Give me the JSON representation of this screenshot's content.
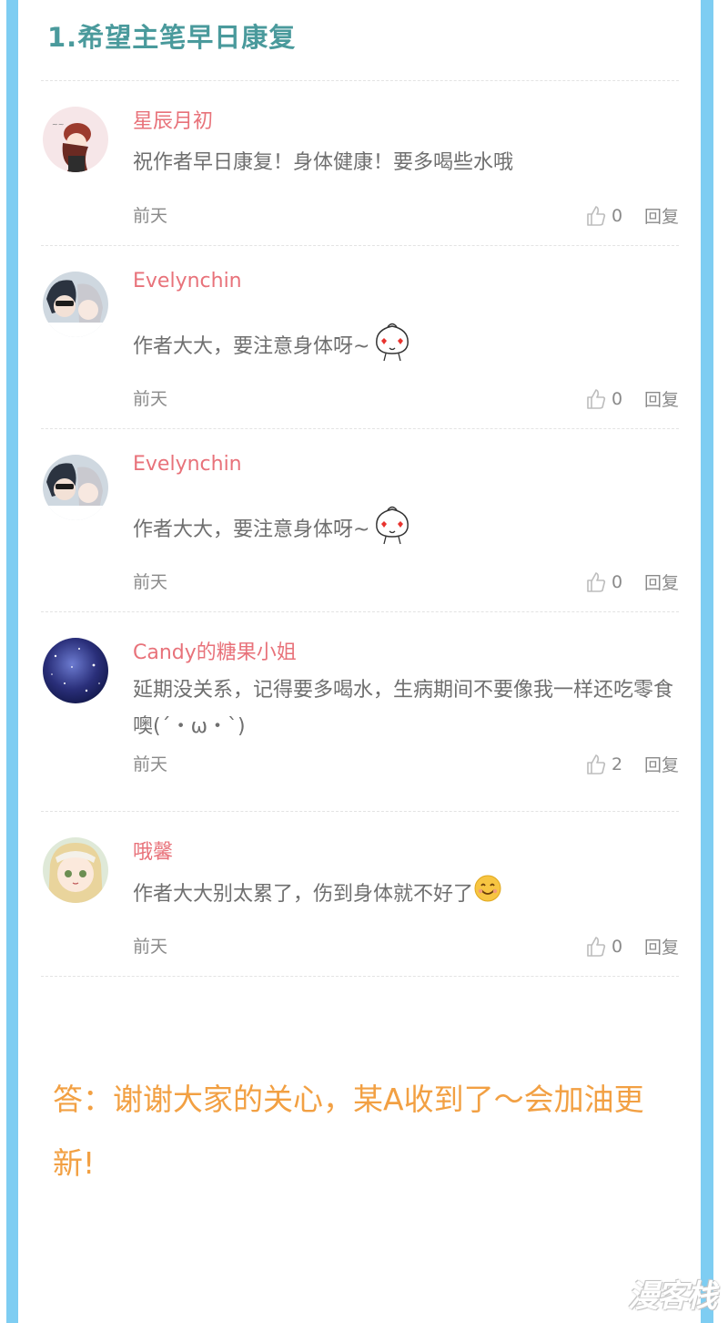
{
  "section": {
    "title": "1.希望主笔早日康复"
  },
  "comments": [
    {
      "user": "星辰月初",
      "text": "祝作者早日康复！身体健康！要多喝些水哦",
      "time": "前天",
      "likes": "0",
      "reply_label": "回复",
      "avatar_icon": "girl-avatar-icon"
    },
    {
      "user": "Evelynchin",
      "text": "作者大大，要注意身体呀~",
      "emoji": "bun-heart-eyes-emoji",
      "time": "前天",
      "likes": "0",
      "reply_label": "回复",
      "avatar_icon": "couple-avatar-icon"
    },
    {
      "user": "Evelynchin",
      "text": "作者大大，要注意身体呀~",
      "emoji": "bun-heart-eyes-emoji",
      "time": "前天",
      "likes": "0",
      "reply_label": "回复",
      "avatar_icon": "couple-avatar-icon"
    },
    {
      "user": "Candy的糖果小姐",
      "text": "延期没关系，记得要多喝水，生病期间不要像我一样还吃零食噢(´・ω・`)",
      "time": "前天",
      "likes": "2",
      "reply_label": "回复",
      "avatar_icon": "galaxy-avatar-icon"
    },
    {
      "user": "哦馨",
      "text": "作者大大别太累了，伤到身体就不好了",
      "emoji": "smiley-emoji",
      "time": "前天",
      "likes": "0",
      "reply_label": "回复",
      "avatar_icon": "anime-girl-avatar-icon"
    }
  ],
  "answer": {
    "prefix": "答：",
    "text": "谢谢大家的关心，某A收到了～会加油更新!"
  },
  "watermark": "漫客栈",
  "colors": {
    "frame": "#7ecdf2",
    "title": "#4a9a9c",
    "username": "#e8727a",
    "answer": "#f2a043"
  }
}
